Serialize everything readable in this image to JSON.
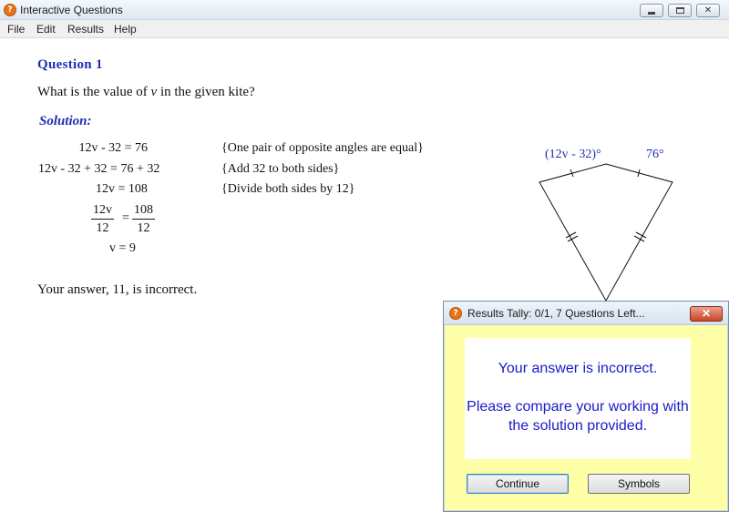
{
  "window": {
    "title": "Interactive Questions",
    "app_icon_glyph": "?"
  },
  "menu": [
    "File",
    "Edit",
    "Results",
    "Help"
  ],
  "question": {
    "title": "Question 1",
    "text_before": "What is the value of ",
    "variable": "v",
    "text_after": " in the given kite?"
  },
  "solution": {
    "label": "Solution",
    "steps": [
      {
        "expr": "12v - 32 = 76",
        "reason": "{One pair of opposite angles are equal}"
      },
      {
        "expr": "12v - 32 + 32 = 76 + 32",
        "reason": "{Add 32 to both sides}"
      },
      {
        "expr": "12v = 108",
        "reason": "{Divide both sides by 12}"
      }
    ],
    "fraction_left": {
      "num": "12v",
      "den": "12"
    },
    "fraction_right": {
      "num": "108",
      "den": "12"
    },
    "final": "v = 9"
  },
  "kite": {
    "angle_left_label": "(12v - 32)°",
    "angle_right_label": "76°"
  },
  "answer_line": "Your answer, 11, is incorrect.",
  "dialog": {
    "title": "Results Tally:  0/1, 7 Questions Left...",
    "close_label": "✕",
    "message_line1": "Your answer is incorrect.",
    "message_line2": "Please compare your working with the solution provided.",
    "continue_label": "Continue",
    "symbols_label": "Symbols"
  }
}
